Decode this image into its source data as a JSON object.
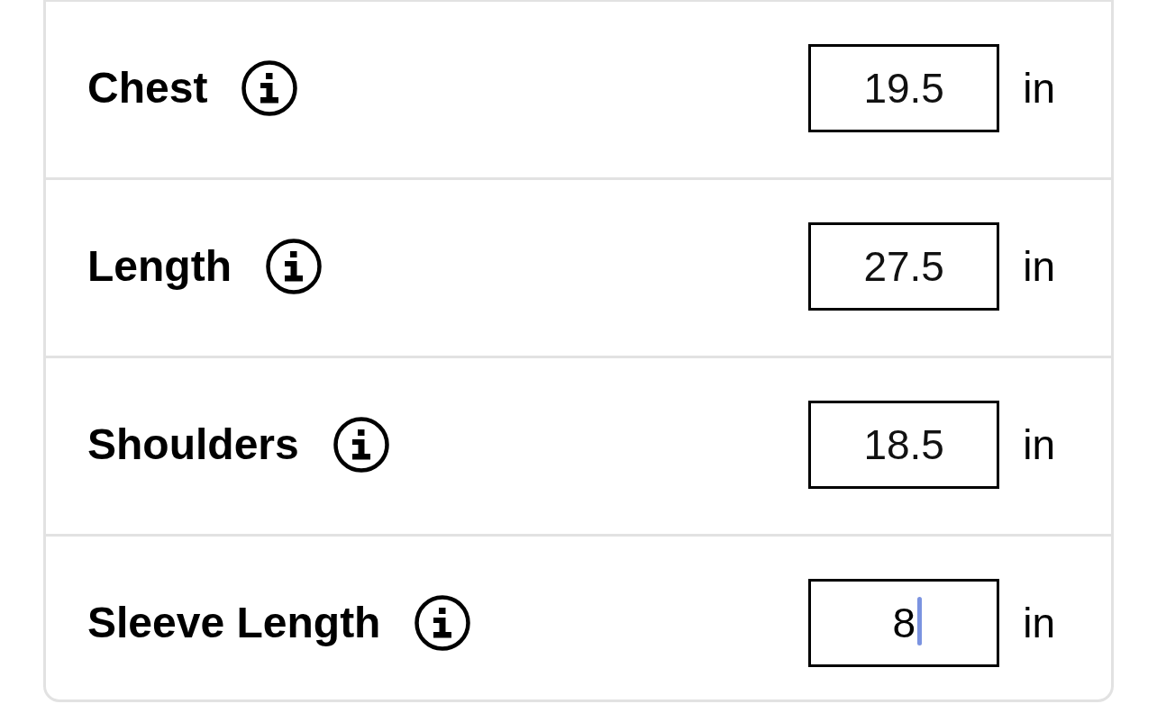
{
  "rows": [
    {
      "label": "Chest",
      "value": "19.5",
      "unit": "in",
      "focused": false
    },
    {
      "label": "Length",
      "value": "27.5",
      "unit": "in",
      "focused": false
    },
    {
      "label": "Shoulders",
      "value": "18.5",
      "unit": "in",
      "focused": false
    },
    {
      "label": "Sleeve Length",
      "value": "8",
      "unit": "in",
      "focused": true
    }
  ]
}
